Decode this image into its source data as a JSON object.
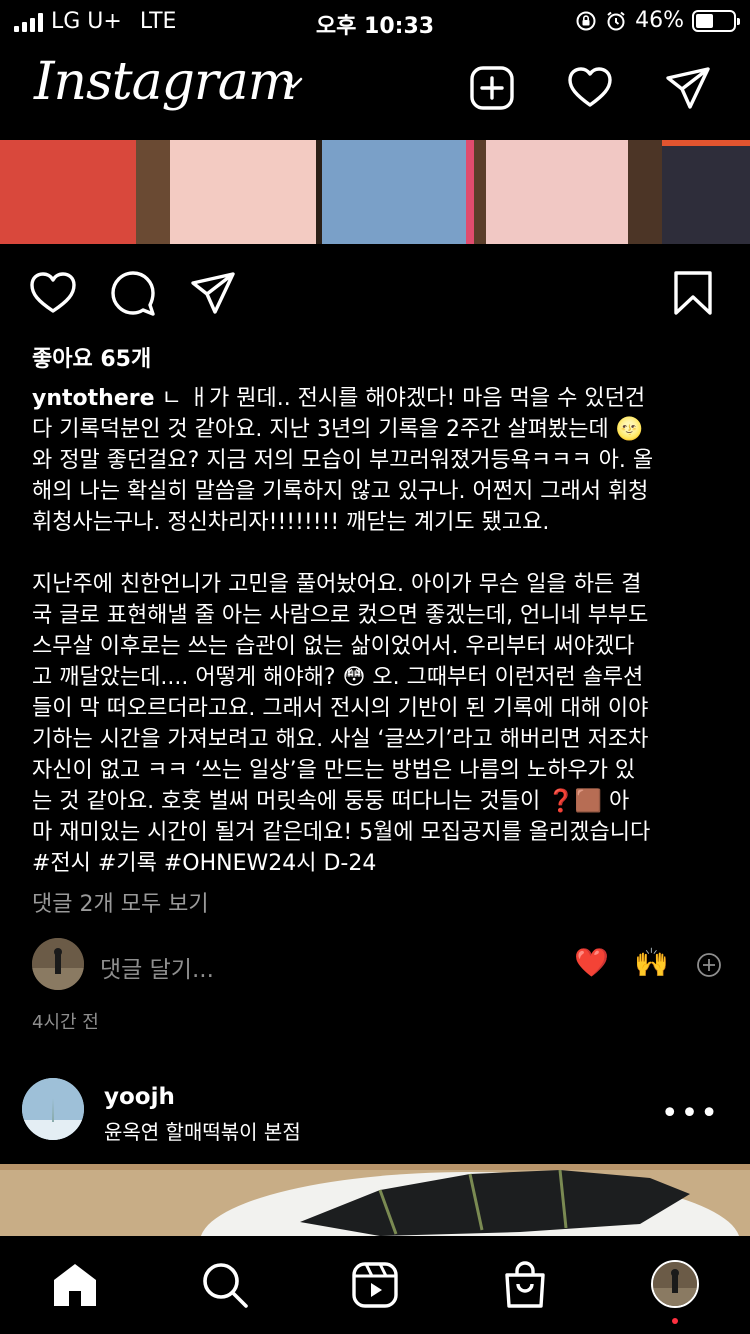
{
  "status_bar": {
    "carrier": "LG U+",
    "network": "LTE",
    "time": "오후 10:33",
    "battery": "46%",
    "battery_level": 0.46
  },
  "header": {
    "logo": "Instagram",
    "icons": [
      "chevron-down-icon",
      "new-post-icon",
      "activity-heart-icon",
      "direct-message-icon"
    ]
  },
  "post": {
    "likes": "좋아요 65개",
    "username": "yntothere",
    "caption_p1": " ㄴ ㅐ가 뭔데.. 전시를 해야겠다! 마음 먹을 수 있던건\n다 기록덕분인 것 같아요. 지난 3년의 기록을 2주간 살펴봤는데 🌝\n와 정말 좋던걸요? 지금 저의 모습이 부끄러워졌거등욕ㅋㅋㅋ 아. 올\n해의 나는 확실히 말씀을 기록하지 않고 있구나. 어쩐지 그래서 휘청\n휘청사는구나. 정신차리자!!!!!!!! 깨닫는 계기도 됐고요.",
    "caption_p2": "지난주에 친한언니가 고민을 풀어놨어요. 아이가 무슨 일을 하든 결\n국 글로 표현해낼 줄 아는 사람으로 컸으면 좋겠는데, 언니네 부부도\n스무살 이후로는 쓰는 습관이 없는 삶이었어서. 우리부터 써야겠다\n고 깨달았는데.... 어떻게 해야해? 😳 오. 그때부터 이런저런 솔루션\n들이 막 떠오르더라고요. 그래서 전시의 기반이 된 기록에 대해 이야\n기하는 시간을 가져보려고 해요. 사실 ‘글쓰기’라고 해버리면 저조차\n자신이 없고 ㅋㅋ ‘쓰는 일상’을 만드는 방법은 나름의 노하우가 있\n는 것 같아요. 호홋 벌써 머릿속에 둥둥 떠다니는 것들이 ❓🟫 아\n마 재미있는 시간이 될거 같은데요! 5월에 모집공지를 올리겠습니다",
    "hashtags": "#전시 #기록 #OHNEW24시 D-24",
    "view_comments": "댓글 2개 모두 보기",
    "add_comment_placeholder": "댓글 달기...",
    "quick_emojis": [
      "❤️",
      "🙌"
    ],
    "timestamp": "4시간 전"
  },
  "next_post": {
    "username": "yoojh",
    "location": "윤옥연 할매떡볶이 본점"
  },
  "tabbar": {
    "tabs": [
      "home-icon",
      "search-icon",
      "reels-icon",
      "shop-icon",
      "profile-avatar"
    ]
  }
}
